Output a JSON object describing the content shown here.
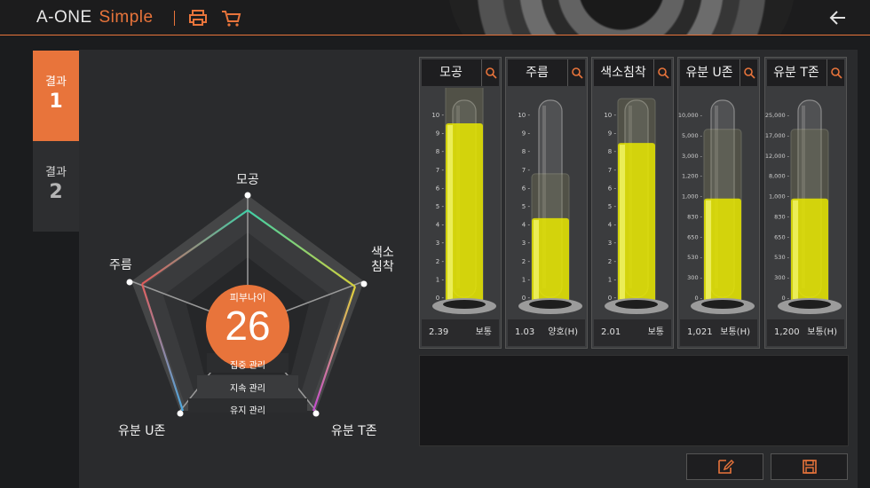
{
  "app": {
    "name": "A-ONE",
    "edition": "Simple"
  },
  "toolbar": {
    "print_icon": "printer-icon",
    "cart_icon": "cart-icon",
    "back_icon": "arrow-left-icon"
  },
  "tabs": [
    {
      "label": "결과",
      "number": "1",
      "active": true
    },
    {
      "label": "결과",
      "number": "2",
      "active": false
    }
  ],
  "radar": {
    "axes": [
      "모공",
      "색소\n침착",
      "유분 T존",
      "유분 U존",
      "주름"
    ],
    "axis_labels": {
      "pore": "모공",
      "pigment_1": "색소",
      "pigment_2": "침착",
      "tzone": "유분 T존",
      "uzone": "유분 U존",
      "wrinkle": "주름"
    },
    "score_caption": "피부나이",
    "score": "26",
    "bands": [
      "집중 관리",
      "지속 관리",
      "유지 관리"
    ]
  },
  "meters": [
    {
      "title": "모공",
      "ticks": [
        "10",
        "9",
        "8",
        "7",
        "6",
        "5",
        "4",
        "3",
        "2",
        "1",
        "0"
      ],
      "value": "2.39",
      "status": "보통",
      "fill_fraction": 0.239
    },
    {
      "title": "주름",
      "ticks": [
        "10",
        "9",
        "8",
        "7",
        "6",
        "5",
        "4",
        "3",
        "2",
        "1",
        "0"
      ],
      "value": "1.03",
      "status": "양호(H)",
      "fill_fraction": 0.103
    },
    {
      "title": "색소침착",
      "ticks": [
        "10",
        "9",
        "8",
        "7",
        "6",
        "5",
        "4",
        "3",
        "2",
        "1",
        "0"
      ],
      "value": "2.01",
      "status": "보통",
      "fill_fraction": 0.201
    },
    {
      "title": "유분 U존",
      "ticks": [
        "10,000",
        "5,000",
        "3,000",
        "1,200",
        "1,000",
        "830",
        "650",
        "530",
        "300",
        "0"
      ],
      "value": "1,021",
      "status": "보통(H)",
      "fill_fraction": 0.54
    },
    {
      "title": "유분 T존",
      "ticks": [
        "25,000",
        "17,000",
        "12,000",
        "8,000",
        "1,000",
        "830",
        "650",
        "530",
        "300",
        "0"
      ],
      "value": "1,200",
      "status": "보통(H)",
      "fill_fraction": 0.54
    }
  ],
  "actions": {
    "edit_icon": "edit-icon",
    "save_icon": "save-icon"
  },
  "colors": {
    "accent": "#e8743b",
    "liquid": "#e8e800"
  }
}
